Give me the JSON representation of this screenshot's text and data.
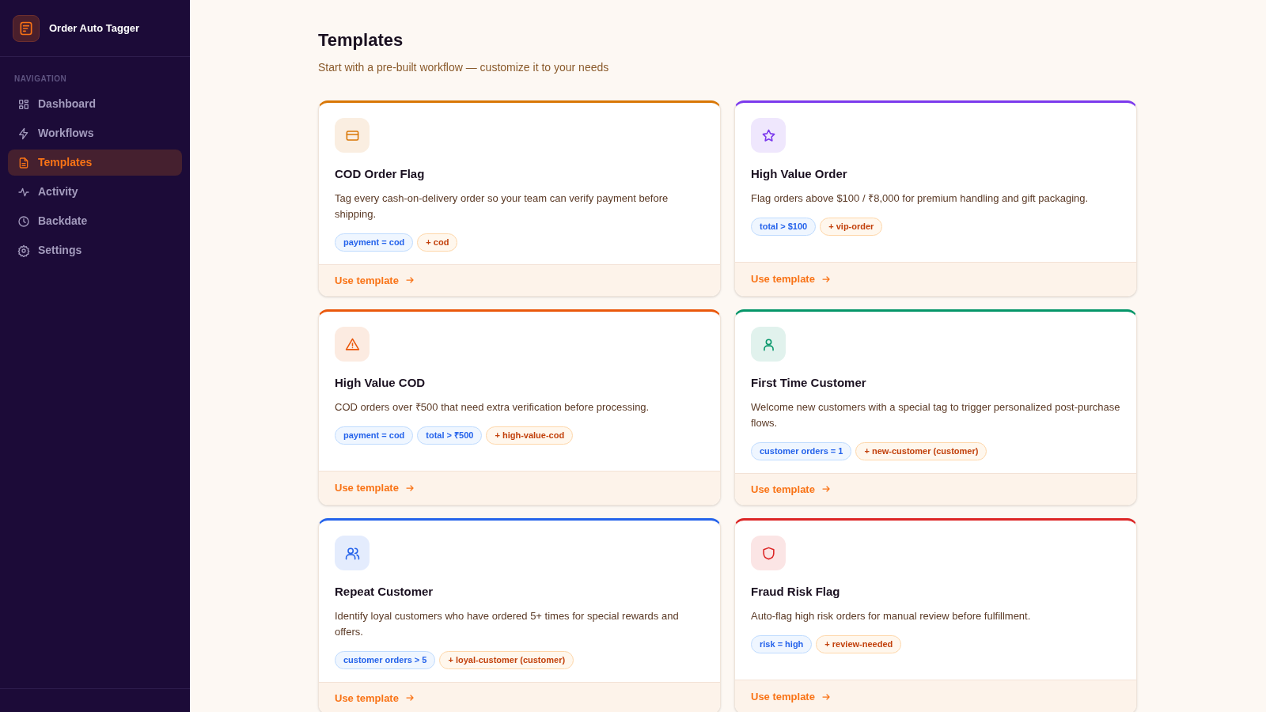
{
  "app": {
    "title": "Order Auto Tagger"
  },
  "sidebar": {
    "section_label": "NAVIGATION",
    "items": [
      {
        "label": "Dashboard",
        "kind": "grid",
        "selected": false
      },
      {
        "label": "Workflows",
        "kind": "bolt",
        "selected": false
      },
      {
        "label": "Templates",
        "kind": "file",
        "selected": true
      },
      {
        "label": "Activity",
        "kind": "pulse",
        "selected": false
      },
      {
        "label": "Backdate",
        "kind": "clock",
        "selected": false
      },
      {
        "label": "Settings",
        "kind": "gear",
        "selected": false
      }
    ]
  },
  "page": {
    "title": "Templates",
    "subtitle": "Start with a pre-built workflow — customize it to your needs"
  },
  "templates": [
    {
      "title": "COD Order Flag",
      "kind": "card",
      "color": "#d97706",
      "description": "Tag every cash-on-delivery order so your team can verify payment before shipping.",
      "pills": [
        {
          "text": "payment = cod",
          "kind": "condition"
        },
        {
          "text": "+ cod",
          "kind": "tag"
        }
      ],
      "action": "Use template"
    },
    {
      "title": "High Value Order",
      "kind": "star",
      "color": "#7c3aed",
      "description": "Flag orders above $100 / ₹8,000 for premium handling and gift packaging.",
      "pills": [
        {
          "text": "total > $100",
          "kind": "condition"
        },
        {
          "text": "+ vip-order",
          "kind": "tag"
        }
      ],
      "action": "Use template"
    },
    {
      "title": "High Value COD",
      "kind": "warning",
      "color": "#ea580c",
      "description": "COD orders over ₹500 that need extra verification before processing.",
      "pills": [
        {
          "text": "payment = cod",
          "kind": "condition"
        },
        {
          "text": "total > ₹500",
          "kind": "condition"
        },
        {
          "text": "+ high-value-cod",
          "kind": "tag"
        }
      ],
      "action": "Use template"
    },
    {
      "title": "First Time Customer",
      "kind": "user",
      "color": "#059669",
      "description": "Welcome new customers with a special tag to trigger personalized post-purchase flows.",
      "pills": [
        {
          "text": "customer orders = 1",
          "kind": "condition"
        },
        {
          "text": "+ new-customer (customer)",
          "kind": "tag"
        }
      ],
      "action": "Use template"
    },
    {
      "title": "Repeat Customer",
      "kind": "users",
      "color": "#2563eb",
      "description": "Identify loyal customers who have ordered 5+ times for special rewards and offers.",
      "pills": [
        {
          "text": "customer orders > 5",
          "kind": "condition"
        },
        {
          "text": "+ loyal-customer (customer)",
          "kind": "tag"
        }
      ],
      "action": "Use template"
    },
    {
      "title": "Fraud Risk Flag",
      "kind": "shield",
      "color": "#dc2626",
      "description": "Auto-flag high risk orders for manual review before fulfillment.",
      "pills": [
        {
          "text": "risk = high",
          "kind": "condition"
        },
        {
          "text": "+ review-needed",
          "kind": "tag"
        }
      ],
      "action": "Use template"
    }
  ]
}
